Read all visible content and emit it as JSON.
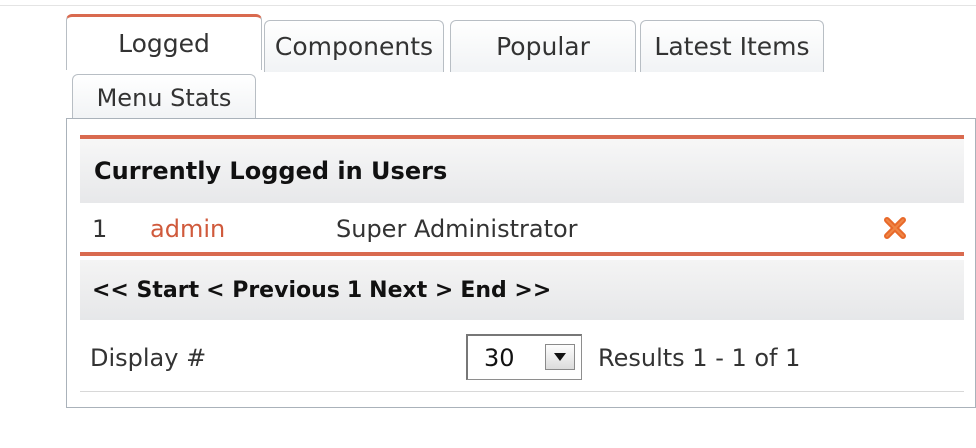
{
  "tabs": [
    {
      "label": "Logged",
      "active": true
    },
    {
      "label": "Components",
      "active": false
    },
    {
      "label": "Popular",
      "active": false
    },
    {
      "label": "Latest Items",
      "active": false
    },
    {
      "label": "Menu Stats",
      "active": false
    }
  ],
  "table": {
    "title": "Currently Logged in Users",
    "rows": [
      {
        "num": "1",
        "username": "admin",
        "group": "Super Administrator",
        "action_icon": "remove-x-icon"
      }
    ]
  },
  "pagination": {
    "start": "<< Start",
    "previous": "< Previous",
    "page": "1",
    "next": "Next >",
    "end": "End >>"
  },
  "display": {
    "label": "Display #",
    "limit": "30",
    "results": "Results 1 - 1 of 1"
  },
  "colors": {
    "accent": "#d96a4f",
    "link": "#d05a3c",
    "remove": "#e8692a"
  }
}
